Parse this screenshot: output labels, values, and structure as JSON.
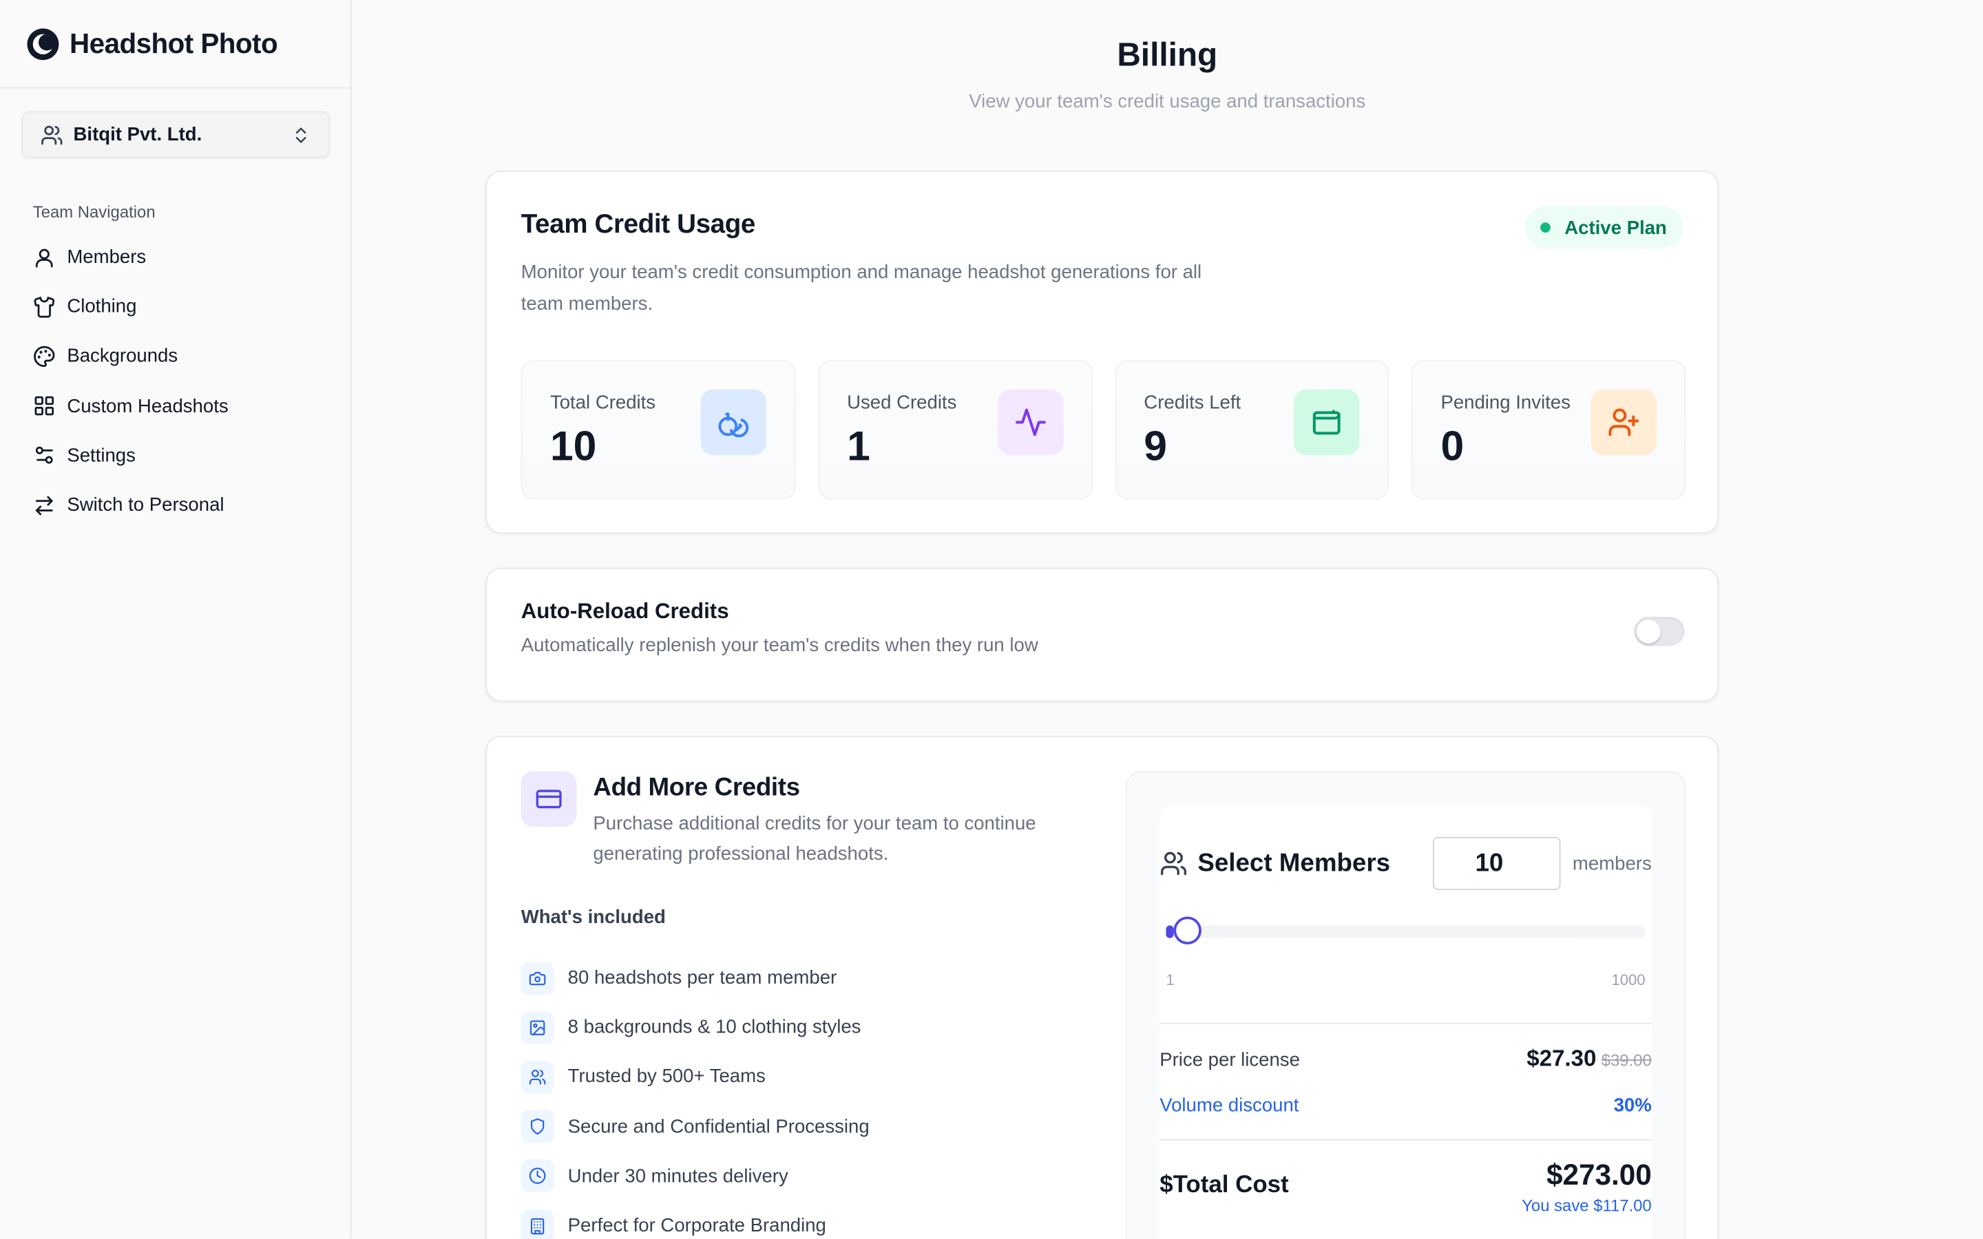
{
  "brand": {
    "name": "Headshot Photo"
  },
  "team_select": {
    "name": "Bitqit Pvt. Ltd."
  },
  "nav": {
    "heading": "Team Navigation",
    "items": [
      {
        "label": "Members",
        "icon": "user-icon"
      },
      {
        "label": "Clothing",
        "icon": "shirt-icon"
      },
      {
        "label": "Backgrounds",
        "icon": "palette-icon"
      },
      {
        "label": "Custom Headshots",
        "icon": "grid-icon"
      },
      {
        "label": "Settings",
        "icon": "sliders-icon"
      },
      {
        "label": "Switch to Personal",
        "icon": "swap-icon"
      }
    ]
  },
  "page": {
    "title": "Billing",
    "subtitle": "View your team's credit usage and transactions"
  },
  "usage": {
    "title": "Team Credit Usage",
    "description": "Monitor your team's credit consumption and manage headshot generations for all team members.",
    "badge": "Active Plan",
    "stats": [
      {
        "label": "Total Credits",
        "value": "10",
        "icon": "coins-icon",
        "color": "#3b82f6",
        "bg": "#dbeafe"
      },
      {
        "label": "Used Credits",
        "value": "1",
        "icon": "activity-icon",
        "color": "#7c3aed",
        "bg": "#f3e8ff"
      },
      {
        "label": "Credits Left",
        "value": "9",
        "icon": "wallet-icon",
        "color": "#059669",
        "bg": "#d1fae5"
      },
      {
        "label": "Pending Invites",
        "value": "0",
        "icon": "user-plus-icon",
        "color": "#ea580c",
        "bg": "#ffedd5"
      }
    ]
  },
  "reload": {
    "title": "Auto-Reload Credits",
    "description": "Automatically replenish your team's credits when they run low",
    "enabled": false
  },
  "add": {
    "title": "Add More Credits",
    "description": "Purchase additional credits for your team to continue generating professional headshots.",
    "included_heading": "What's included",
    "included": [
      {
        "text": "80 headshots per team member",
        "icon": "camera-icon"
      },
      {
        "text": "8 backgrounds & 10 clothing styles",
        "icon": "image-icon"
      },
      {
        "text": "Trusted by 500+ Teams",
        "icon": "users-icon"
      },
      {
        "text": "Secure and Confidential Processing",
        "icon": "shield-icon"
      },
      {
        "text": "Under 30 minutes delivery",
        "icon": "clock-icon"
      },
      {
        "text": "Perfect for Corporate Branding",
        "icon": "building-icon"
      }
    ],
    "calculator": {
      "select_label": "Select Members",
      "members_value": "10",
      "members_unit": "members",
      "slider_min": "1",
      "slider_max": "1000",
      "slider_value": 10,
      "price_label": "Price per license",
      "price_now": "$27.30",
      "price_was": "$39.00",
      "discount_label": "Volume discount",
      "discount_value": "30%",
      "total_label": "$Total Cost",
      "total_value": "$273.00",
      "savings": "You save $117.00"
    }
  },
  "colors": {
    "accent": "#4f46e5",
    "link": "#2563eb",
    "success": "#10b981"
  }
}
